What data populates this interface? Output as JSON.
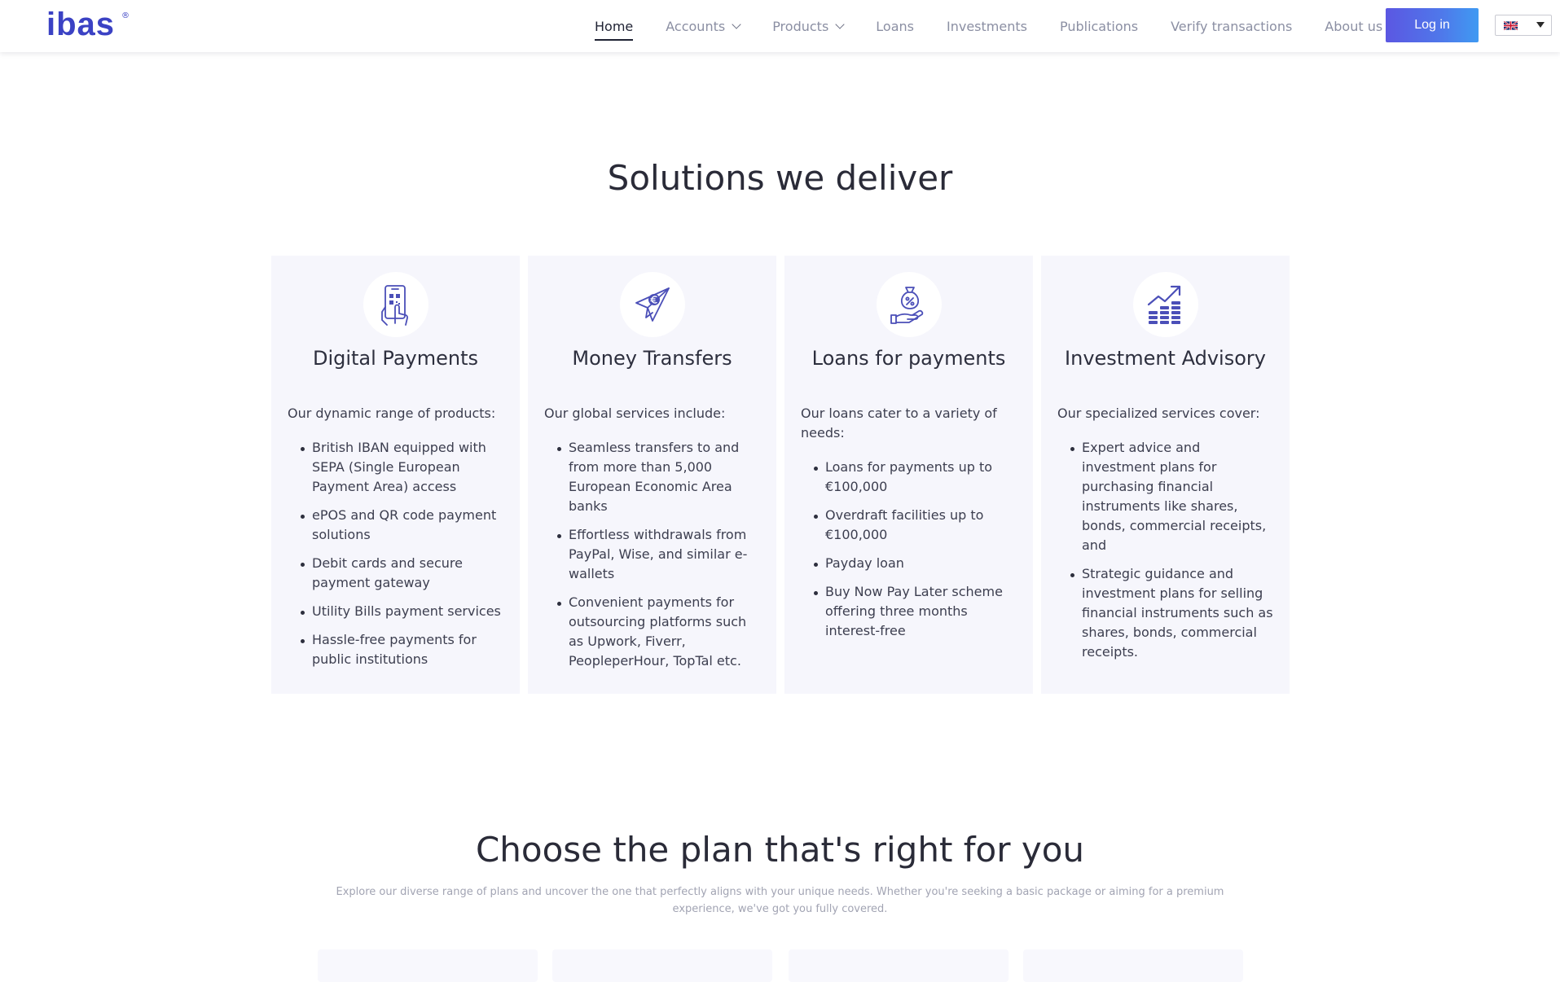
{
  "brand": {
    "logo_text": "ibas",
    "logo_mark": "®",
    "accent_color": "#3b42c4"
  },
  "nav": {
    "items": [
      {
        "label": "Home",
        "active": true,
        "dropdown": false
      },
      {
        "label": "Accounts",
        "active": false,
        "dropdown": true
      },
      {
        "label": "Products",
        "active": false,
        "dropdown": true
      },
      {
        "label": "Loans",
        "active": false,
        "dropdown": false
      },
      {
        "label": "Investments",
        "active": false,
        "dropdown": false
      },
      {
        "label": "Publications",
        "active": false,
        "dropdown": false
      },
      {
        "label": "Verify transactions",
        "active": false,
        "dropdown": false
      },
      {
        "label": "About us",
        "active": false,
        "dropdown": true
      }
    ],
    "login_label": "Log in",
    "language_icon": "uk-flag-icon"
  },
  "solutions": {
    "title": "Solutions we deliver",
    "cards": [
      {
        "icon": "phone-qr-tap-icon",
        "title": "Digital Payments",
        "intro": "Our dynamic range of products:",
        "items": [
          "British IBAN equipped with SEPA (Single European Payment Area) access",
          "ePOS and QR code payment solutions",
          "Debit cards and secure payment gateway",
          "Utility Bills payment services",
          "Hassle-free payments for public institutions"
        ]
      },
      {
        "icon": "paper-plane-euro-icon",
        "title": "Money Transfers",
        "intro": "Our global services include:",
        "items": [
          "Seamless transfers to and from more than 5,000 European Economic Area banks",
          "Effortless withdrawals from PayPal, Wise, and similar e-wallets",
          "Convenient payments for outsourcing platforms such as Upwork, Fiverr, PeopleperHour, TopTal etc."
        ]
      },
      {
        "icon": "hand-money-bag-percent-icon",
        "title": "Loans for payments",
        "intro": "Our loans cater to a variety of needs:",
        "items": [
          "Loans for payments up to €100,000",
          "Overdraft facilities up to €100,000",
          "Payday loan",
          "Buy Now Pay Later scheme offering three months interest-free"
        ]
      },
      {
        "icon": "growth-chart-stacks-icon",
        "title": "Investment Advisory",
        "intro": "Our specialized services cover:",
        "items": [
          "Expert advice and investment plans for purchasing financial instruments like shares, bonds, commercial receipts, and",
          "Strategic guidance and investment plans for selling financial instruments such as shares, bonds, commercial receipts."
        ]
      }
    ]
  },
  "plans": {
    "title": "Choose the plan that's right for you",
    "description": "Explore our diverse range of plans and uncover the one that perfectly aligns with your unique needs. Whether you're seeking a basic package or aiming for a premium experience, we've got you fully covered."
  }
}
